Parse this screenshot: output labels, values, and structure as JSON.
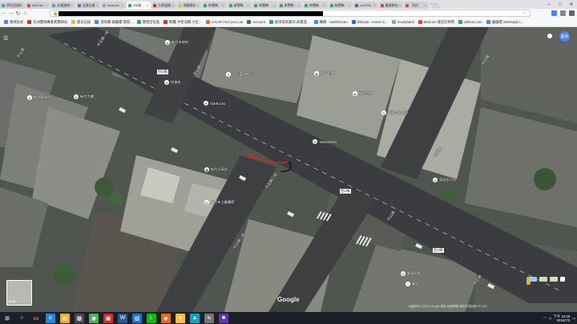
{
  "browser": {
    "tabs": [
      {
        "title": "評估記錄表",
        "color": "#5b8fd0"
      },
      {
        "title": "MaiCoin",
        "color": "#e5463a"
      },
      {
        "title": "交通違規",
        "color": "#4ba0d8"
      },
      {
        "title": "全國法規",
        "color": "#3d7acb"
      },
      {
        "title": "www.lev",
        "color": "#9aa0a6"
      },
      {
        "title": "238號",
        "color": "#34a853",
        "active": true
      },
      {
        "title": "大阪道路",
        "color": "#d93025"
      },
      {
        "title": "地圖資料",
        "color": "#fbbc04"
      },
      {
        "title": "新聞稿",
        "color": "#34a853"
      },
      {
        "title": "新聞稿",
        "color": "#34a853"
      },
      {
        "title": "新聞稿",
        "color": "#34a853"
      },
      {
        "title": "新聞稿",
        "color": "#34a853"
      },
      {
        "title": "新聞稿",
        "color": "#34a853"
      },
      {
        "title": "新聞稿",
        "color": "#34a853"
      },
      {
        "title": "vol1900",
        "color": "#5f6368"
      },
      {
        "title": "豐藝網站",
        "color": "#ea4335"
      },
      {
        "title": "【包】",
        "color": "#ea4335"
      }
    ],
    "nav": {
      "back": "←",
      "forward": "→",
      "reload": "↻",
      "home": "⌂"
    },
    "address_prefix": "🔒",
    "bookmarks": [
      {
        "label": "應用程式",
        "color": "#4285f4"
      },
      {
        "label": "亞洲雙碼專業買賣網站",
        "color": "#d93025"
      },
      {
        "label": "歷史記錄",
        "color": "#fbbc04"
      },
      {
        "label": "速易購 蘭藏樓 煙環...",
        "color": "#4285f4"
      },
      {
        "label": "整理型投進",
        "color": "#34a853"
      },
      {
        "label": "鮮蠶 半徑海鷗 大型...",
        "color": "#d93025"
      },
      {
        "label": "U-CAR Find your car",
        "color": "#e8710a"
      },
      {
        "label": "Account",
        "color": "#5f6368"
      },
      {
        "label": "經濟部商業司-商業登...",
        "color": "#34a853"
      },
      {
        "label": "機構 · HashOcean",
        "color": "#4285f4"
      },
      {
        "label": "Bittrade - invest in...",
        "color": "#1a73e8"
      },
      {
        "label": "hourlybank",
        "color": "#9aa0a6"
      },
      {
        "label": "MaiCoin 便宜比特幣",
        "color": "#e5463a"
      },
      {
        "label": "abfund.com",
        "color": "#34a853"
      },
      {
        "label": "優優標 SiteRapid.c...",
        "color": "#4285f4"
      }
    ]
  },
  "map": {
    "user_initials": "嘉武",
    "menu_icon": "☰",
    "road_labels": [
      {
        "text": "中山路"
      },
      {
        "text": "中正路一段"
      },
      {
        "text": "中山路"
      },
      {
        "text": "中正路二段"
      },
      {
        "text": "中正路二段"
      },
      {
        "text": "自由路"
      },
      {
        "text": "中正路"
      },
      {
        "text": "中山路"
      },
      {
        "text": "中正路"
      }
    ],
    "route_codes": [
      {
        "text": "台1線"
      },
      {
        "text": "台1線"
      },
      {
        "text": "台1線"
      }
    ],
    "pois": [
      {
        "label": "新竹市政府"
      },
      {
        "label": "台北富邦銀行"
      },
      {
        "label": "統一超商"
      },
      {
        "label": "新竹縣政府"
      },
      {
        "label": "StarBucks"
      },
      {
        "label": "新竹大樓"
      },
      {
        "label": "府後街"
      },
      {
        "label": "新光三越"
      },
      {
        "label": "國泰世華銀行"
      },
      {
        "label": "TaiwanBank"
      },
      {
        "label": "新竹火車站"
      },
      {
        "label": "東區區公所"
      },
      {
        "label": "新竹市立圖書館"
      },
      {
        "label": "國泰證券"
      },
      {
        "label": "藥局"
      }
    ],
    "earth_label": "Earth",
    "google_logo": "Google",
    "footer": "地圖資料 ©2016 Google   條款   回報問題   傳送意見回饋   50 公尺"
  },
  "taskbar": {
    "apps": [
      {
        "name": "start",
        "glyph": "⊞",
        "color": "#1c1f26"
      },
      {
        "name": "search",
        "glyph": "○",
        "color": "#1c1f26"
      },
      {
        "name": "task-view",
        "glyph": "▭",
        "color": "#1c1f26"
      },
      {
        "name": "edge",
        "glyph": "e",
        "color": "#1e88e5"
      },
      {
        "name": "explorer",
        "glyph": "▤",
        "color": "#f2b01e"
      },
      {
        "name": "store",
        "glyph": "▦",
        "color": "#4a4a4a"
      },
      {
        "name": "chrome",
        "glyph": "◉",
        "color": "#4caf50"
      },
      {
        "name": "pdf",
        "glyph": "▣",
        "color": "#d32f2f"
      },
      {
        "name": "word",
        "glyph": "W",
        "color": "#2b579a"
      },
      {
        "name": "app-blue",
        "glyph": "▥",
        "color": "#1976d2"
      },
      {
        "name": "line",
        "glyph": "L",
        "color": "#00c300"
      },
      {
        "name": "app-orange",
        "glyph": "◆",
        "color": "#ef6c00"
      },
      {
        "name": "app-yellow",
        "glyph": "●",
        "color": "#fbc02d"
      },
      {
        "name": "app-cyan",
        "glyph": "▲",
        "color": "#00acc1"
      },
      {
        "name": "app-gray",
        "glyph": "✎",
        "color": "#757575"
      },
      {
        "name": "app-purple",
        "glyph": "■",
        "color": "#5e35b1"
      }
    ],
    "time": "下午 10:49",
    "date": "2016/7/3"
  }
}
